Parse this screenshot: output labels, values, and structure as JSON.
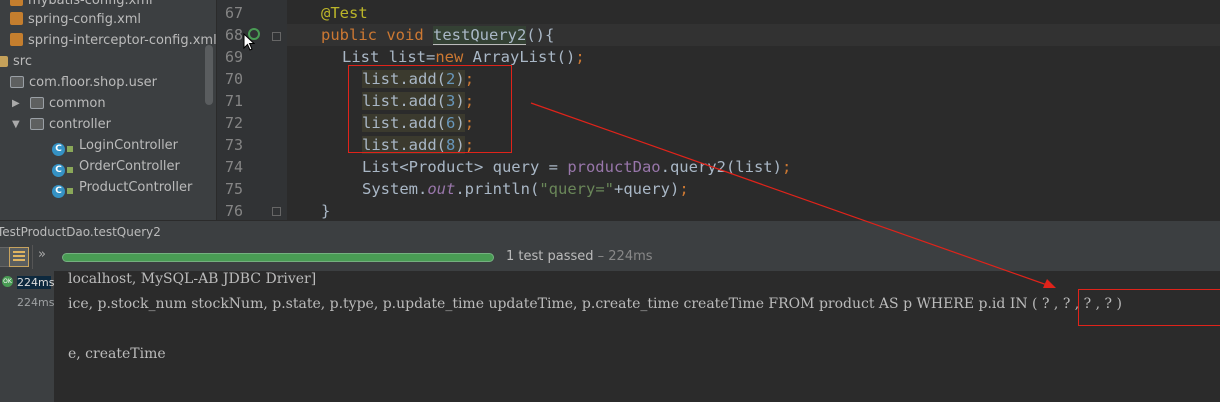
{
  "project_tree": {
    "items": [
      {
        "label": "mybatis-config.xml",
        "kind": "xml"
      },
      {
        "label": "spring-config.xml",
        "kind": "xml"
      },
      {
        "label": "spring-interceptor-config.xml",
        "kind": "xml"
      },
      {
        "label": "src",
        "kind": "folder"
      },
      {
        "label": "com.floor.shop.user",
        "kind": "package"
      },
      {
        "label": "common",
        "kind": "package"
      },
      {
        "label": "controller",
        "kind": "package"
      },
      {
        "label": "LoginController",
        "kind": "class"
      },
      {
        "label": "OrderController",
        "kind": "class"
      },
      {
        "label": "ProductController",
        "kind": "class"
      }
    ]
  },
  "editor": {
    "line_numbers": [
      "67",
      "68",
      "69",
      "70",
      "71",
      "72",
      "73",
      "74",
      "75",
      "76"
    ],
    "code": {
      "l67": "@Test",
      "l68_public": "public",
      "l68_void": "void",
      "l68_name": "testQuery2",
      "l68_rest": "(){",
      "l69_a": "List list=",
      "l69_new": "new",
      "l69_b": " ArrayList()",
      "l69_semi": ";",
      "l70_call": "list.add(",
      "l70_num": "2",
      "l71_num": "3",
      "l72_num": "6",
      "l73_num": "8",
      "add_close": ")",
      "l74_a": "List<Product> query = ",
      "l74_field": "productDao",
      "l74_b": ".query2(list)",
      "l75_a": "System.",
      "l75_out": "out",
      "l75_b": ".println(",
      "l75_str": "\"query=\"",
      "l75_c": "+query)",
      "l76": "}"
    }
  },
  "run_panel": {
    "tab_title": "TestProductDao.testQuery2",
    "status": "1 test passed",
    "status_time": " – 224ms",
    "progress": 1.0,
    "test_tree": {
      "badge": "OK",
      "times": [
        "224ms",
        "224ms"
      ]
    },
    "console_lines": [
      "localhost, MySQL-AB JDBC Driver]",
      "ice, p.stock_num stockNum, p.state, p.type, p.update_time updateTime, p.create_time createTime FROM product AS p WHERE p.id IN ( ? , ? , ? , ? )",
      "e, createTime"
    ]
  },
  "colors": {
    "editor_bg": "#2b2b2b",
    "panel_bg": "#3c3f41",
    "annotation_red": "#e0231a",
    "pass_green": "#499c54"
  }
}
